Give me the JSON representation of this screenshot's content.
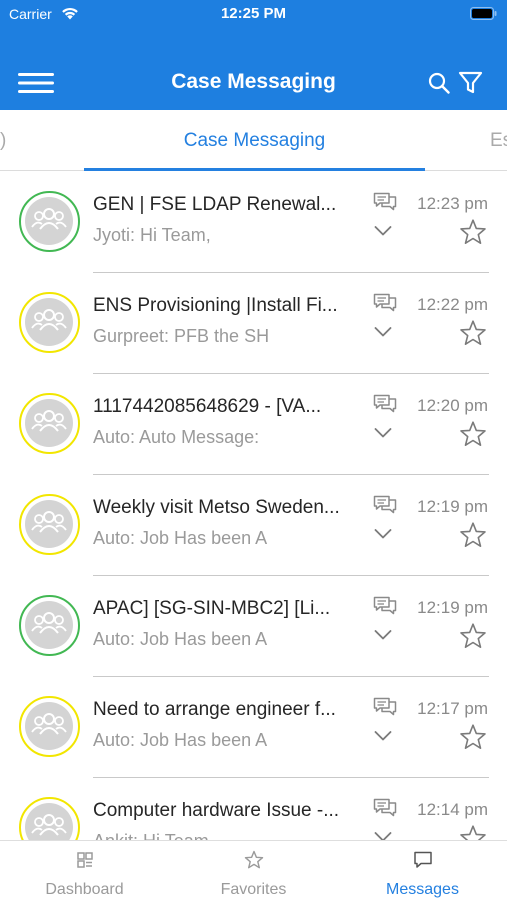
{
  "status_bar": {
    "carrier": "Carrier",
    "time": "12:25 PM"
  },
  "navbar": {
    "title": "Case Messaging"
  },
  "tabs": {
    "prev_label": ")",
    "active_label": "Case Messaging",
    "next_label": "Es"
  },
  "colors": {
    "primary": "#1e7fe0",
    "accent_text": "#2480e0",
    "status_green": "#42b853",
    "status_yellow": "#f2e600"
  },
  "messages": [
    {
      "title": "GEN | FSE LDAP Renewal...",
      "preview": "Jyoti: Hi Team,",
      "time": "12:23 pm",
      "status": "green"
    },
    {
      "title": "ENS Provisioning |Install Fi...",
      "preview": "Gurpreet: PFB the SH",
      "time": "12:22 pm",
      "status": "yellow"
    },
    {
      "title": "1117442085648629 - [VA...",
      "preview": "Auto: Auto Message:",
      "time": "12:20 pm",
      "status": "yellow"
    },
    {
      "title": "Weekly visit Metso Sweden...",
      "preview": "Auto: Job Has been A",
      "time": "12:19 pm",
      "status": "yellow"
    },
    {
      "title": "APAC] [SG-SIN-MBC2] [Li...",
      "preview": "Auto: Job Has been A",
      "time": "12:19 pm",
      "status": "green"
    },
    {
      "title": "Need to arrange engineer f...",
      "preview": "Auto: Job Has been A",
      "time": "12:17 pm",
      "status": "yellow"
    },
    {
      "title": "Computer hardware Issue -...",
      "preview": "Ankit: Hi Team,",
      "time": "12:14 pm",
      "status": "yellow"
    }
  ],
  "bottom_bar": {
    "dashboard_label": "Dashboard",
    "favorites_label": "Favorites",
    "messages_label": "Messages"
  }
}
